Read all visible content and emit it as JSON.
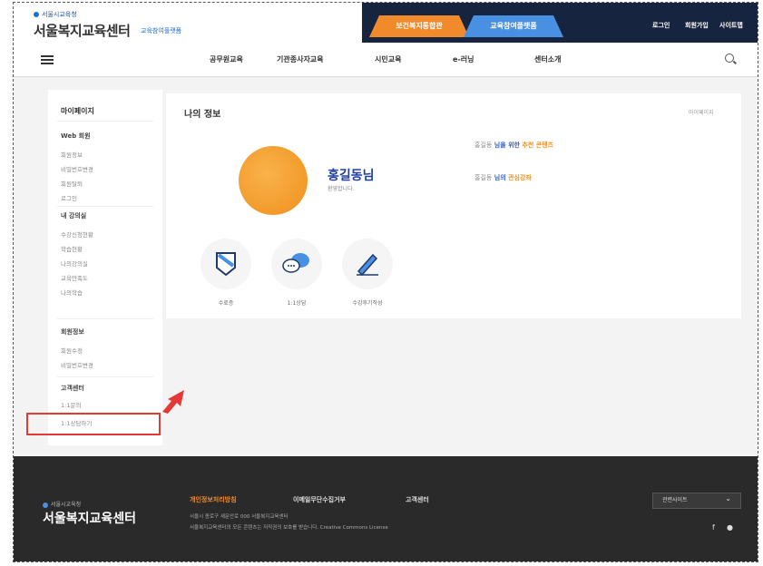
{
  "header": {
    "logo_small": "서울시교육청",
    "logo_main": "서울복지교육센터",
    "logo_sub": "교육참여플랫폼",
    "tab_orange": "보건복지통합관",
    "tab_blue": "교육참여플랫폼",
    "util": [
      "로그인",
      "회원가입",
      "사이트맵"
    ]
  },
  "nav": {
    "items": [
      "공무원교육",
      "기관종사자교육",
      "시민교육",
      "e-러닝",
      "센터소개"
    ]
  },
  "sidebar": {
    "title": "마이페이지",
    "sections": [
      {
        "label": "Web 회원",
        "items": [
          "회원정보",
          "비밀번호변경",
          "회원탈퇴",
          "로그인"
        ]
      },
      {
        "label": "내 강의실",
        "items": [
          "수강신청현황",
          "학습현황",
          "나의강의실",
          "교육만족도",
          "나의학습"
        ]
      },
      {
        "label": "회원정보",
        "items": [
          "회원수정",
          "비밀번호변경"
        ]
      },
      {
        "label": "고객센터",
        "items": [
          "1:1문의",
          "1:1상담하기"
        ]
      }
    ]
  },
  "main": {
    "title": "나의 정보",
    "link": "마이페이지",
    "user_name": "홍길동님",
    "user_sub": "환영합니다.",
    "promo1_prefix": "홍길동",
    "promo1_text": "님을 위한",
    "promo1_em": "추천 콘텐츠",
    "promo2_prefix": "홍길동",
    "promo2_text": "님의",
    "promo2_em": "관심강좌",
    "icons": [
      {
        "name": "certificate",
        "label": "수료증"
      },
      {
        "name": "chat",
        "label": "1:1상담"
      },
      {
        "name": "pen",
        "label": "수강후기작성"
      }
    ]
  },
  "footer": {
    "logo_small": "서울시교육청",
    "logo": "서울복지교육센터",
    "links": [
      "개인정보처리방침",
      "이메일무단수집거부",
      "고객센터"
    ],
    "address": "서울시 종로구 새문안로 000 서울복지교육센터",
    "copyright": "서울복지교육센터의 모든 콘텐츠는 저작권의 보호를 받습니다. Creative Commons License",
    "select_label": "관련사이트",
    "social": [
      "f",
      "●"
    ]
  },
  "colors": {
    "navy": "#17243f",
    "orange": "#f08a2b",
    "blue": "#4a90e2",
    "highlight": "#e53935"
  }
}
